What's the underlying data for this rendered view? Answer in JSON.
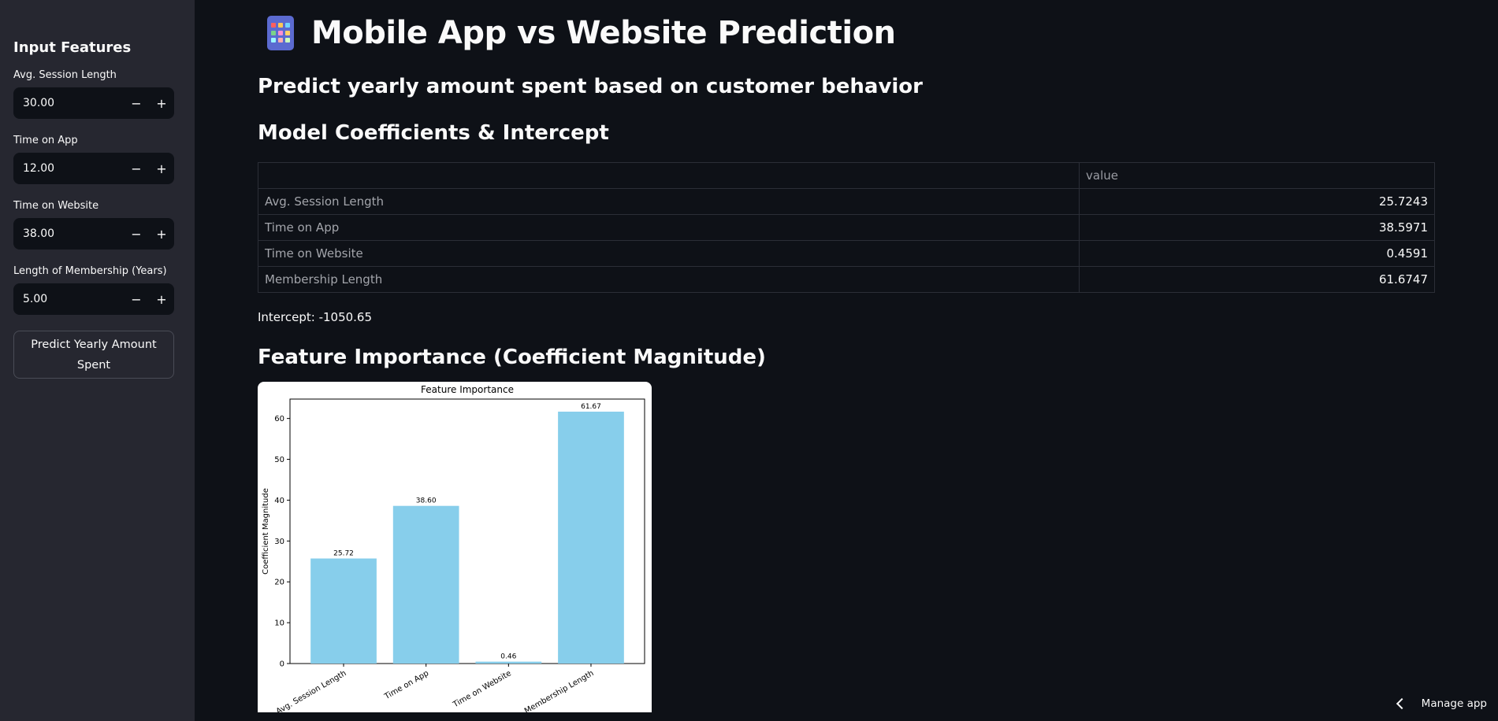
{
  "sidebar": {
    "title": "Input Features",
    "fields": [
      {
        "label": "Avg. Session Length",
        "value": "30.00"
      },
      {
        "label": "Time on App",
        "value": "12.00"
      },
      {
        "label": "Time on Website",
        "value": "38.00"
      },
      {
        "label": "Length of Membership (Years)",
        "value": "5.00"
      }
    ],
    "minus_symbol": "−",
    "plus_symbol": "+",
    "predict_button": "Predict Yearly Amount Spent"
  },
  "main": {
    "title": "Mobile App vs Website Prediction",
    "title_icon": "mobile-phone-icon",
    "subtitle": "Predict yearly amount spent based on customer behavior",
    "coef_heading": "Model Coefficients & Intercept",
    "table": {
      "columns": [
        "",
        "value"
      ],
      "rows": [
        {
          "name": "Avg. Session Length",
          "value": "25.7243"
        },
        {
          "name": "Time on App",
          "value": "38.5971"
        },
        {
          "name": "Time on Website",
          "value": "0.4591"
        },
        {
          "name": "Membership Length",
          "value": "61.6747"
        }
      ]
    },
    "intercept": "Intercept: -1050.65",
    "importance_heading": "Feature Importance (Coefficient Magnitude)"
  },
  "chart_data": {
    "type": "bar",
    "title": "Feature Importance",
    "xlabel": "",
    "ylabel": "Coefficient Magnitude",
    "categories": [
      "Avg. Session Length",
      "Time on App",
      "Time on Website",
      "Membership Length"
    ],
    "values": [
      25.72,
      38.6,
      0.46,
      61.67
    ],
    "data_labels": [
      "25.72",
      "38.60",
      "0.46",
      "61.67"
    ],
    "ylim": [
      0,
      64.75
    ],
    "yticks": [
      0,
      10,
      20,
      30,
      40,
      50,
      60
    ],
    "bar_color": "#87ceeb",
    "grid": false
  },
  "footer": {
    "manage_app": "Manage app"
  },
  "colors": {
    "background": "#0e1117",
    "sidebar": "#262730"
  }
}
